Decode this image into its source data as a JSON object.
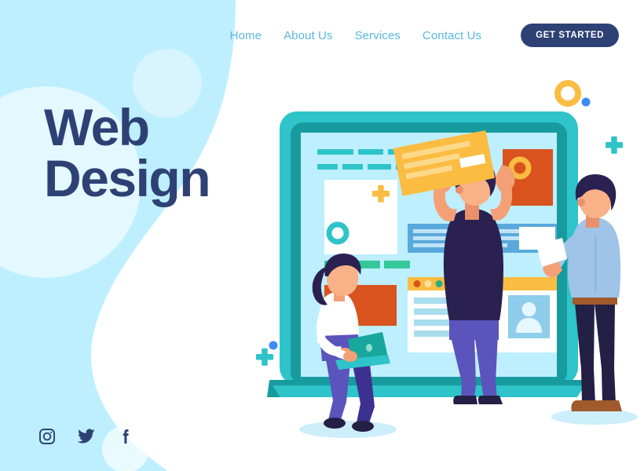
{
  "page": {
    "background_color": "#ffffff",
    "blob_color": "#bdefff",
    "blob_color_light": "#e3f8ff",
    "navy": "#2e4175",
    "nav_link_color": "#5bb8e0",
    "teal": "#2ec4c9",
    "teal_dark": "#189b9e",
    "orange": "#d9531e",
    "yellow": "#fbbc42",
    "blue_dot": "#3d8bf2"
  },
  "nav": {
    "links": [
      {
        "label": "Home",
        "name": "nav-link-home"
      },
      {
        "label": "About Us",
        "name": "nav-link-about-us"
      },
      {
        "label": "Services",
        "name": "nav-link-services"
      },
      {
        "label": "Contact Us",
        "name": "nav-link-contact-us"
      }
    ],
    "cta": {
      "label": "GET STARTED"
    }
  },
  "hero": {
    "line1": "Web",
    "line2": "Design"
  },
  "social": {
    "items": [
      {
        "name": "instagram-icon",
        "label": "Instagram"
      },
      {
        "name": "twitter-icon",
        "label": "Twitter"
      },
      {
        "name": "facebook-icon",
        "label": "Facebook"
      }
    ]
  },
  "illustration": {
    "alt": "Three people building a website on a large laptop screen",
    "laptop": {
      "frame_color": "#2ec4c9",
      "inner_frame_color": "#189b9e",
      "screen_color": "#bdefff"
    },
    "screen_cards": {
      "text_lines_teal": "#2ec4c9",
      "white_card": "#ffffff",
      "plus_yellow": "#fbbc42",
      "ring_teal": "#2ec4c9",
      "green_pills": "#35c79a",
      "orange_block": "#d9531e",
      "orange_ring": "#fbbc42",
      "blue_block": "#5aa9dc",
      "browser_bar_yellow": "#fbbc42",
      "browser_dots": [
        "#d9531e",
        "#fbe0a0",
        "#27ae80"
      ],
      "avatar_bg": "#8ecdeb"
    },
    "characters": [
      {
        "name": "woman-with-laptop",
        "shirt": "#ffffff",
        "pants": "#5b54bc",
        "hair": "#2a2150"
      },
      {
        "name": "man-holding-card",
        "shirt": "#2a2150",
        "pants": "#5b54bc",
        "card": "#fbbc42"
      },
      {
        "name": "man-pointing",
        "shirt": "#9fc4e8",
        "pants": "#241f45",
        "shoes": "#a05a2c"
      }
    ],
    "decor": [
      {
        "name": "orange-ring-decor",
        "color": "#fbbc42"
      },
      {
        "name": "blue-dot-decor",
        "color": "#3d8bf2"
      },
      {
        "name": "teal-plus-decor-right",
        "color": "#2ec4c9"
      },
      {
        "name": "teal-plus-decor-left",
        "color": "#2ec4c9"
      }
    ]
  }
}
